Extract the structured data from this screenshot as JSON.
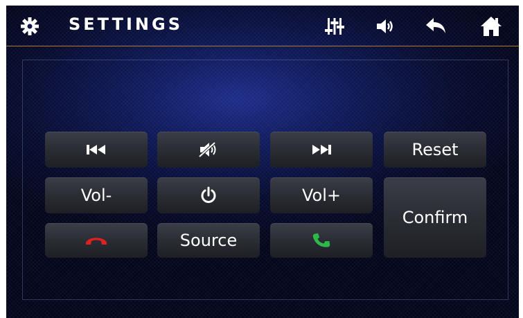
{
  "header": {
    "title": "SETTINGS",
    "icons": [
      "gear-icon",
      "equalizer-icon",
      "volume-icon",
      "back-arrow-icon",
      "home-icon"
    ]
  },
  "buttons": {
    "prev_track": {
      "icon": "skip-previous-icon"
    },
    "mute": {
      "icon": "mute-icon"
    },
    "next_track": {
      "icon": "skip-next-icon"
    },
    "reset": {
      "label": "Reset"
    },
    "vol_down": {
      "label": "Vol-"
    },
    "power": {
      "icon": "power-icon"
    },
    "vol_up": {
      "label": "Vol+"
    },
    "confirm": {
      "label": "Confirm"
    },
    "hang_up": {
      "icon": "hang-up-icon",
      "color": "#e02020"
    },
    "source": {
      "label": "Source"
    },
    "call": {
      "icon": "phone-call-icon",
      "color": "#2fb84a"
    }
  },
  "colors": {
    "divider": "#b87a2a",
    "background": "#0b1348"
  }
}
